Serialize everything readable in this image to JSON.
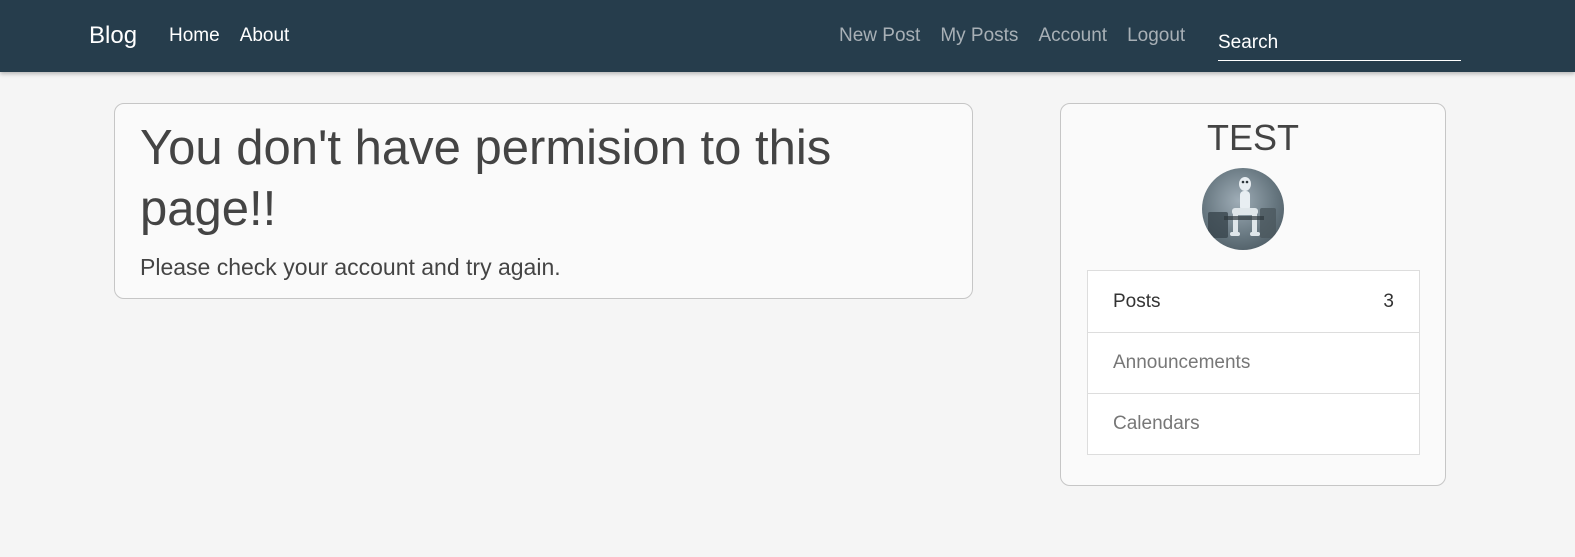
{
  "navbar": {
    "brand": "Blog",
    "left_links": [
      "Home",
      "About"
    ],
    "right_links": [
      "New Post",
      "My Posts",
      "Account",
      "Logout"
    ],
    "search": {
      "placeholder": "Search",
      "value": ""
    }
  },
  "main": {
    "title": "You don't have permision to this page!!",
    "message": "Please check your account and try again."
  },
  "sidebar": {
    "username": "TEST",
    "items": [
      {
        "label": "Posts",
        "count": "3"
      },
      {
        "label": "Announcements"
      },
      {
        "label": "Calendars"
      }
    ]
  },
  "colors": {
    "navbar_bg": "#263d4c",
    "page_bg": "#f5f5f5",
    "muted_link": "#a8b0b6"
  }
}
